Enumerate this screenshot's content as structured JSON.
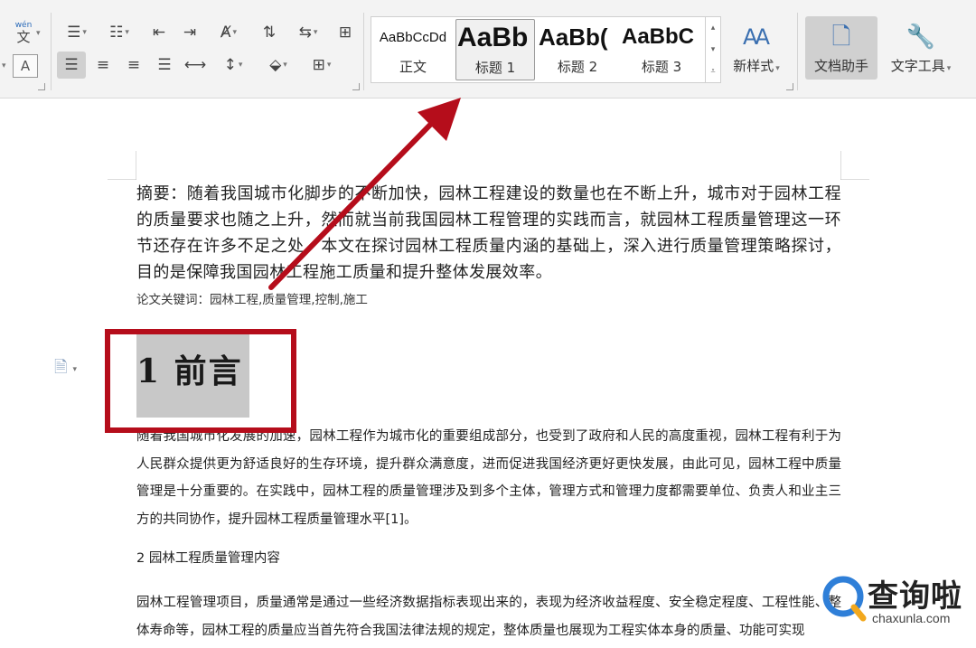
{
  "ribbon": {
    "pinyin_label": "wén",
    "pinyin_glyph": "文",
    "char_a": "A",
    "styles": [
      {
        "preview": "AaBbCcDd",
        "label": "正文"
      },
      {
        "preview": "AaBb",
        "label": "标题 1"
      },
      {
        "preview": "AaBb(",
        "label": "标题 2"
      },
      {
        "preview": "AaBbC",
        "label": "标题 3"
      }
    ],
    "new_style": "新样式",
    "doc_assistant": "文档助手",
    "text_tools": "文字工具"
  },
  "document": {
    "abstract": "摘要：随着我国城市化脚步的不断加快，园林工程建设的数量也在不断上升，城市对于园林工程的质量要求也随之上升，然而就当前我国园林工程管理的实践而言，就园林工程质量管理这一环节还存在许多不足之处，本文在探讨园林工程质量内涵的基础上，深入进行质量管理策略探讨，目的是保障我国园林工程施工质量和提升整体发展效率。",
    "keywords": "论文关键词：园林工程,质量管理,控制,施工",
    "heading": "1 前言",
    "body1": "随着我国城市化发展的加速，园林工程作为城市化的重要组成部分，也受到了政府和人民的高度重视，园林工程有利于为人民群众提供更为舒适良好的生存环境，提升群众满意度，进而促进我国经济更好更快发展，由此可见，园林工程中质量管理是十分重要的。在实践中，园林工程的质量管理涉及到多个主体，管理方式和管理力度都需要单位、负责人和业主三方的共同协作，提升园林工程质量管理水平[1]。",
    "section2": "2 园林工程质量管理内容",
    "body2": "园林工程管理项目，质量通常是通过一些经济数据指标表现出来的，表现为经济收益程度、安全稳定程度、工程性能、整体寿命等，园林工程的质量应当首先符合我国法律法规的规定，整体质量也展现为工程实体本身的质量、功能可实现"
  },
  "watermark": {
    "brand": "查询啦",
    "domain": "chaxunla.com"
  },
  "colors": {
    "annotation_red": "#b50d1b",
    "selection_gray": "#c8c8c8",
    "watermark_blue": "#2f7fd8"
  }
}
